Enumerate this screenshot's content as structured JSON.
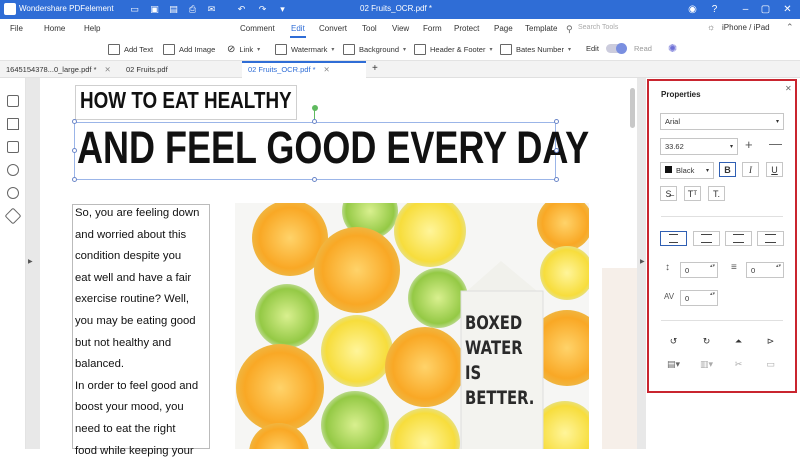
{
  "app": {
    "name": "Wondershare PDFelement",
    "document_title": "02 Fruits_OCR.pdf *"
  },
  "menu": {
    "left": [
      "File",
      "Home",
      "Help"
    ],
    "main": [
      "Comment",
      "Edit",
      "Convert",
      "Tool",
      "View",
      "Form",
      "Protect",
      "Page",
      "Template"
    ],
    "active": "Edit",
    "search_placeholder": "Search Tools",
    "device": "iPhone / iPad"
  },
  "toolbar": {
    "add_text": "Add Text",
    "add_image": "Add Image",
    "link": "Link",
    "watermark": "Watermark",
    "background": "Background",
    "header_footer": "Header & Footer",
    "bates_number": "Bates Number",
    "edit": "Edit",
    "read": "Read"
  },
  "tabs": [
    {
      "label": "1645154378...0_large.pdf *",
      "active": false
    },
    {
      "label": "02 Fruits.pdf",
      "active": false
    },
    {
      "label": "02 Fruits_OCR.pdf *",
      "active": true
    }
  ],
  "document": {
    "heading1": "HOW TO EAT HEALTHY",
    "heading2": "AND FEEL GOOD EVERY DAY",
    "body_lines": [
      "So, you are feeling down",
      "and worried about this",
      "condition despite you",
      "eat well and have a fair",
      "exercise routine? Well,",
      "you may be eating good",
      "but not healthy and",
      "balanced.",
      "In order to feel good and",
      "boost your mood, you",
      "need to eat the right",
      "food while keeping your"
    ],
    "carton_text": [
      "BOXED",
      "WATER",
      "IS",
      "BETTER."
    ]
  },
  "properties": {
    "title": "Properties",
    "font": "Arial",
    "size": "33.62",
    "color_name": "Black",
    "color_hex": "#000000",
    "line_spacing": "0",
    "paragraph_spacing": "0",
    "char_spacing": "0"
  },
  "colors": {
    "accent": "#2f6dd6",
    "highlight_frame": "#c9252f",
    "orange": "#f7a21b",
    "lemon": "#f6dc3a",
    "lime": "#8cc63e"
  }
}
